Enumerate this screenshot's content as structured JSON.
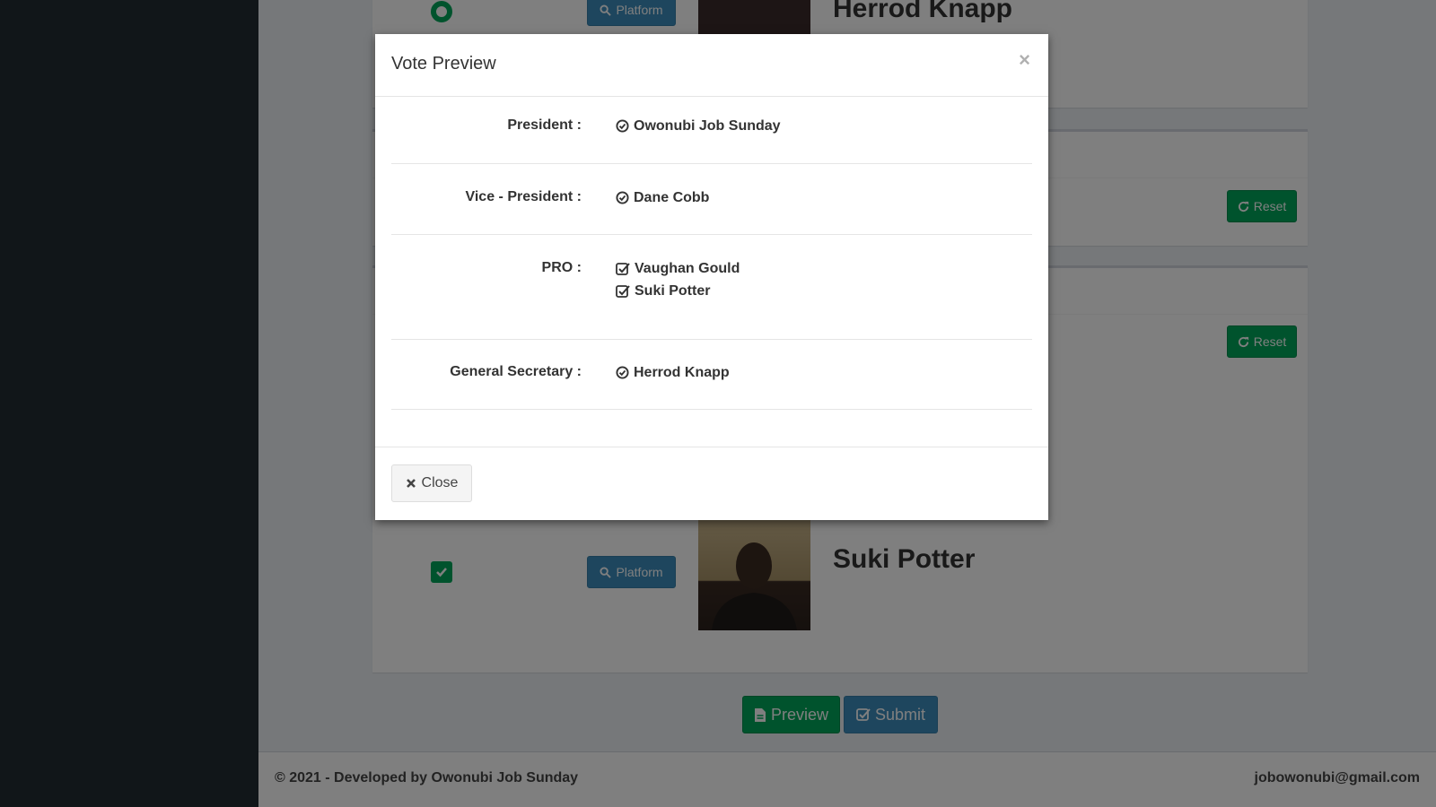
{
  "background": {
    "top_candidate": {
      "name": "Herrod Knapp",
      "platform_label": "Platform"
    },
    "reset_label": "Reset",
    "bottom_candidate": {
      "name": "Suki Potter",
      "platform_label": "Platform"
    },
    "actions": {
      "preview_label": "Preview",
      "submit_label": "Submit"
    }
  },
  "footer": {
    "copyright": "© 2021 - Developed by Owonubi Job Sunday",
    "email": "jobowonubi@gmail.com"
  },
  "modal": {
    "title": "Vote Preview",
    "close_x": "×",
    "rows": [
      {
        "label": "President :",
        "values": [
          "Owonubi Job Sunday"
        ],
        "icon": "check-circle-icon"
      },
      {
        "label": "Vice - President :",
        "values": [
          "Dane Cobb"
        ],
        "icon": "check-circle-icon"
      },
      {
        "label": "PRO :",
        "values": [
          "Vaughan Gould",
          "Suki Potter"
        ],
        "icon": "check-square-icon"
      },
      {
        "label": "General Secretary :",
        "values": [
          "Herrod Knapp"
        ],
        "icon": "check-circle-icon"
      }
    ],
    "close_button_label": "Close"
  },
  "colors": {
    "sidebar": "#222d32",
    "primary": "#3c8dbc",
    "success": "#00a65a",
    "backdrop": "rgba(0,0,0,0.5)"
  }
}
